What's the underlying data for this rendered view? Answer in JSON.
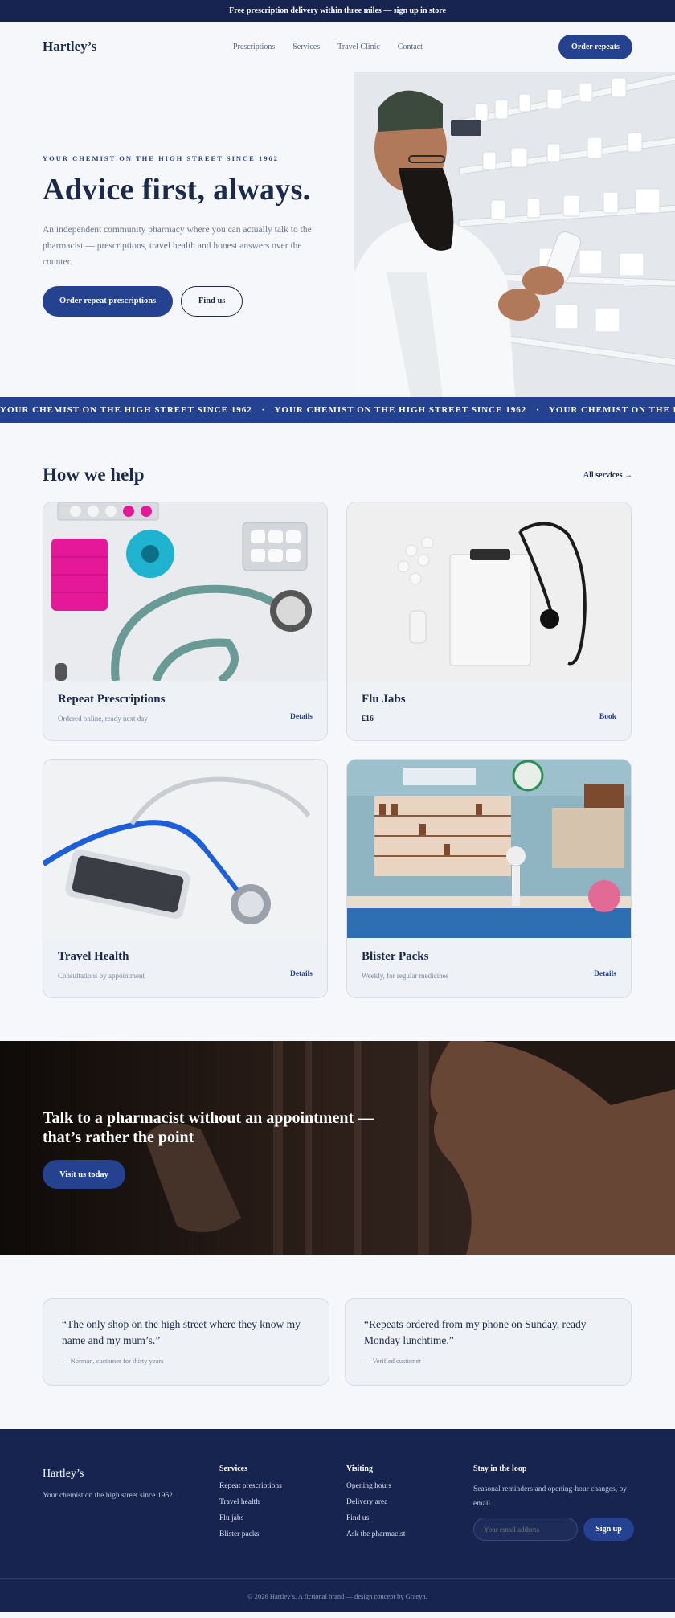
{
  "announcement": "Free prescription delivery within three miles — sign up in store",
  "nav": {
    "logo": "Hartley’s",
    "links": [
      "Prescriptions",
      "Services",
      "Travel Clinic",
      "Contact"
    ],
    "cta": "Order repeats"
  },
  "hero": {
    "eyebrow": "YOUR CHEMIST ON THE HIGH STREET SINCE 1962",
    "title": "Advice first, always.",
    "subtitle": "An independent community pharmacy where you can actually talk to the pharmacist — prescriptions, travel health and honest answers over the counter.",
    "primary_button": "Order repeat prescriptions",
    "secondary_button": "Find us"
  },
  "marquee": {
    "text": "YOUR CHEMIST ON THE HIGH STREET SINCE 1962",
    "separator": "·"
  },
  "help": {
    "title": "How we help",
    "all_link": "All services →",
    "cards": [
      {
        "title": "Repeat Prescriptions",
        "subtitle": "Ordered online, ready next day",
        "link": "Details"
      },
      {
        "title": "Flu Jabs",
        "price": "£16",
        "link": "Book"
      },
      {
        "title": "Travel Health",
        "subtitle": "Consultations by appointment",
        "link": "Details"
      },
      {
        "title": "Blister Packs",
        "subtitle": "Weekly, for regular medicines",
        "link": "Details"
      }
    ]
  },
  "banner": {
    "title": "Talk to a pharmacist without an appointment — that’s rather the point",
    "button": "Visit us today"
  },
  "testimonials": [
    {
      "quote": "“The only shop on the high street where they know my name and my mum’s.”",
      "author": "— Norman, customer for thirty years"
    },
    {
      "quote": "“Repeats ordered from my phone on Sunday, ready Monday lunchtime.”",
      "author": "— Verified customer"
    }
  ],
  "footer": {
    "brand": "Hartley’s",
    "tagline": "Your chemist on the high street since 1962.",
    "services": {
      "title": "Services",
      "links": [
        "Repeat prescriptions",
        "Travel health",
        "Flu jabs",
        "Blister packs"
      ]
    },
    "visiting": {
      "title": "Visiting",
      "links": [
        "Opening hours",
        "Delivery area",
        "Find us",
        "Ask the pharmacist"
      ]
    },
    "newsletter": {
      "title": "Stay in the loop",
      "text": "Seasonal reminders and opening-hour changes, by email.",
      "placeholder": "Your email address",
      "button": "Sign up"
    },
    "copyright": "© 2026 Hartley’s. A fictional brand — design concept by Graeyn."
  }
}
